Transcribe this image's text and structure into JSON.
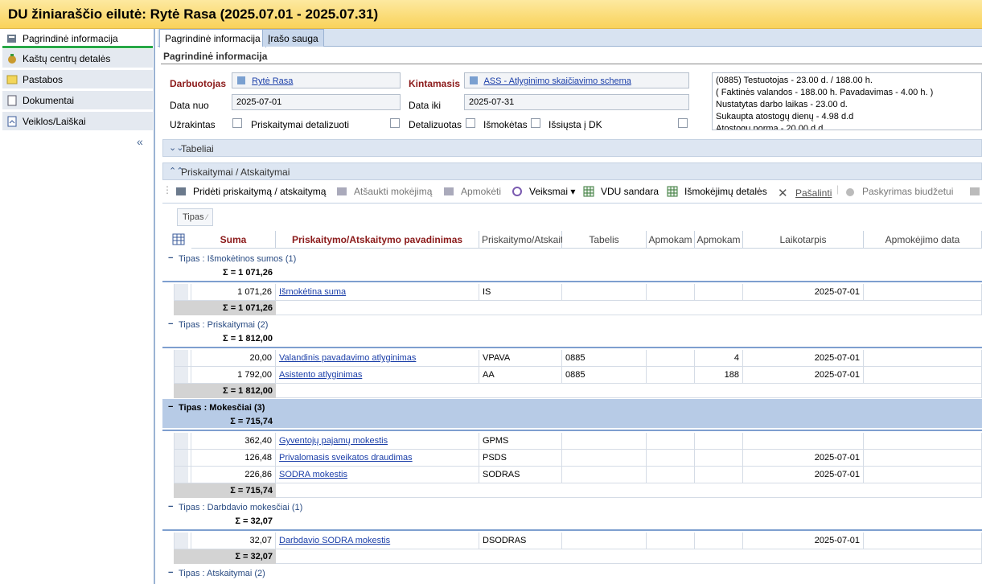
{
  "window": {
    "title": "DU žiniaraščio eilutė: Rytė Rasa (2025.07.01 - 2025.07.31)"
  },
  "sidebar": {
    "items": [
      {
        "label": "Pagrindinė informacija",
        "icon": "info-card-icon"
      },
      {
        "label": "Kaštų centrų detalės",
        "icon": "money-bag-icon"
      },
      {
        "label": "Pastabos",
        "icon": "note-icon"
      },
      {
        "label": "Dokumentai",
        "icon": "document-icon"
      },
      {
        "label": "Veiklos/Laiškai",
        "icon": "activity-icon"
      }
    ],
    "collapse_glyph": "«"
  },
  "tabs": [
    {
      "label": "Pagrindinė informacija"
    },
    {
      "label": "Įrašo sauga"
    }
  ],
  "form": {
    "section_title": "Pagrindinė informacija",
    "darbuotojas_label": "Darbuotojas",
    "darbuotojas_value": "Rytė Rasa",
    "kintamasis_label": "Kintamasis",
    "kintamasis_value": "ASS - Atlyginimo skaičiavimo schema",
    "data_nuo_label": "Data nuo",
    "data_nuo_value": "2025-07-01",
    "data_iki_label": "Data iki",
    "data_iki_value": "2025-07-31",
    "uzrakintas_label": "Užrakintas",
    "priskaitymai_detalizuoti_label": "Priskaitymai detalizuoti",
    "detalizuotas_label": "Detalizuotas",
    "ismoketas_label": "Išmokėtas",
    "issiusta_dk_label": "Išsiųsta į DK",
    "info_lines": [
      "(0885) Testuotojas - 23.00 d. / 188.00 h.",
      "( Faktinės valandos - 188.00 h. Pavadavimas - 4.00 h. )",
      "Nustatytas darbo laikas - 23.00 d.",
      "Sukaupta atostogų dienų - 4.98 d.d",
      "Atostogų norma - 20.00 d.d"
    ]
  },
  "panels": {
    "tabeliai": "Tabeliai",
    "priskaitymai": "Priskaitymai / Atskaitymai"
  },
  "toolbar": [
    {
      "label": "Pridėti priskaitymą / atskaitymą",
      "enabled": true
    },
    {
      "label": "Atšaukti mokėjimą",
      "enabled": false
    },
    {
      "label": "Apmokėti",
      "enabled": false
    },
    {
      "label": "Veiksmai",
      "enabled": true
    },
    {
      "label": "VDU sandara",
      "enabled": true
    },
    {
      "label": "Išmokėjimų detalės",
      "enabled": true
    },
    {
      "label": "Pašalinti",
      "enabled": false
    },
    {
      "label": "Paskyrimas biudžetui",
      "enabled": false
    }
  ],
  "grid": {
    "tipas_button": "Tipas",
    "headers": [
      "Suma",
      "Priskaitymo/Atskaitymo pavadinimas",
      "Priskaitymo/Atskait",
      "Tabelis",
      "Apmokam",
      "Apmokam",
      "Laikotarpis",
      "Apmokėjimo data"
    ],
    "groups": [
      {
        "title": "Tipas : Išmokėtinos sumos (1)",
        "sum": "Σ = 1 071,26",
        "footer_sum": "Σ = 1 071,26",
        "rows": [
          {
            "suma": "1 071,26",
            "name": "Išmokėtina suma",
            "code": "IS",
            "tabelis": "",
            "ap1": "",
            "ap2": "",
            "laik": "2025-07-01"
          }
        ]
      },
      {
        "title": "Tipas : Priskaitymai (2)",
        "sum": "Σ = 1 812,00",
        "footer_sum": "Σ = 1 812,00",
        "rows": [
          {
            "suma": "20,00",
            "name": "Valandinis pavadavimo atlyginimas",
            "code": "VPAVA",
            "tabelis": "0885",
            "ap1": "",
            "ap2": "4",
            "laik": "2025-07-01"
          },
          {
            "suma": "1 792,00",
            "name": "Asistento atlyginimas",
            "code": "AA",
            "tabelis": "0885",
            "ap1": "",
            "ap2": "188",
            "laik": "2025-07-01"
          }
        ]
      },
      {
        "title": "Tipas : Mokesčiai (3)",
        "sum": "Σ = 715,74",
        "footer_sum": "Σ = 715,74",
        "rows": [
          {
            "suma": "362,40",
            "name": "Gyventojų pajamų mokestis",
            "code": "GPMS",
            "tabelis": "",
            "ap1": "",
            "ap2": "",
            "laik": ""
          },
          {
            "suma": "126,48",
            "name": "Privalomasis sveikatos draudimas",
            "code": "PSDS",
            "tabelis": "",
            "ap1": "",
            "ap2": "",
            "laik": "2025-07-01"
          },
          {
            "suma": "226,86",
            "name": "SODRA mokestis",
            "code": "SODRAS",
            "tabelis": "",
            "ap1": "",
            "ap2": "",
            "laik": "2025-07-01"
          }
        ]
      },
      {
        "title": "Tipas : Darbdavio mokesčiai (1)",
        "sum": "Σ = 32,07",
        "footer_sum": "Σ = 32,07",
        "rows": [
          {
            "suma": "32,07",
            "name": "Darbdavio SODRA mokestis",
            "code": "DSODRAS",
            "tabelis": "",
            "ap1": "",
            "ap2": "",
            "laik": "2025-07-01"
          }
        ]
      },
      {
        "title": "Tipas : Atskaitymai (2)"
      }
    ]
  }
}
